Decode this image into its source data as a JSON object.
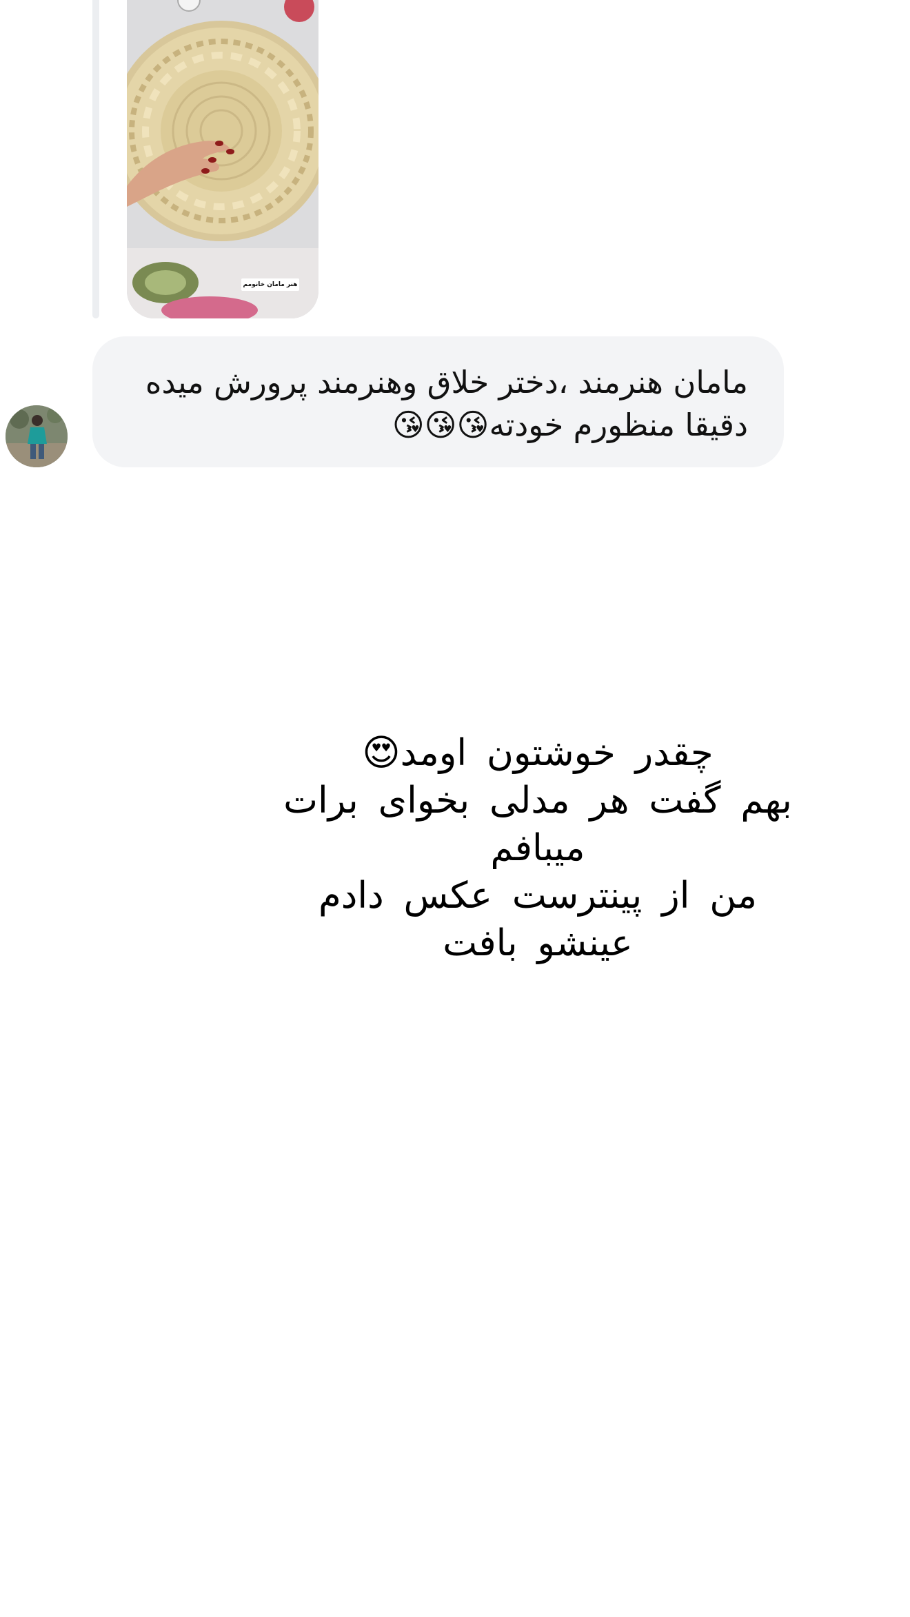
{
  "colors": {
    "background": "#ffffff",
    "bubble": "#f3f4f6",
    "reply_bar": "#eceef1",
    "text": "#111111"
  },
  "story_reply": {
    "image_caption": "هنر مامان خانومم",
    "image_description": "crochet-placemat-photo"
  },
  "incoming_message": {
    "avatar_icon": "user-avatar",
    "line1": "مامان هنرمند ،دختر خلاق وهنرمند پرورش میده",
    "line2": "دقیقا منظورم خودته😘😘😘"
  },
  "status_text": {
    "line1": "چقدر خوشتون اومد😍",
    "line2": "بهم گفت هر مدلی بخوای برات",
    "line3": "میبافم",
    "line4": "من از پینترست عکس دادم",
    "line5": "عینشو بافت"
  }
}
